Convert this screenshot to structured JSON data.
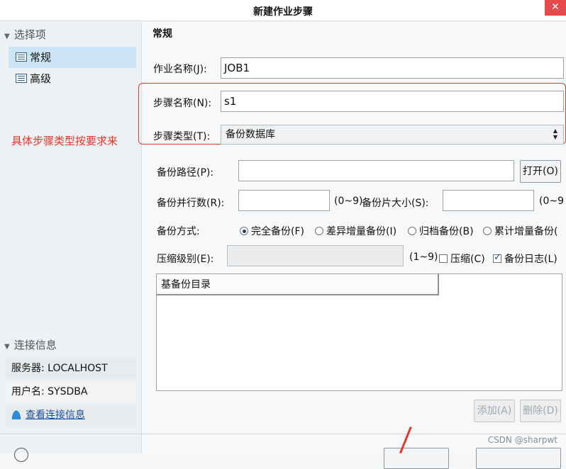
{
  "window": {
    "title": "新建作业步骤",
    "close": "✕"
  },
  "sidebar": {
    "options_header": "选择项",
    "items": [
      {
        "label": "常规",
        "icon": "list-icon",
        "active": true
      },
      {
        "label": "高级",
        "icon": "list-icon",
        "active": false
      }
    ],
    "connection_header": "连接信息",
    "server": "服务器: LOCALHOST",
    "user": "用户名: SYSDBA",
    "view_link": "查看连接信息"
  },
  "annotation": "具体步骤类型按要求来",
  "form": {
    "section": "常规",
    "job_name_label": "作业名称(J):",
    "job_name": "JOB1",
    "step_name_label": "步骤名称(N):",
    "step_name": "s1",
    "step_type_label": "步骤类型(T):",
    "step_type": "备份数据库",
    "backup_path_label": "备份路径(P):",
    "backup_path": "",
    "open_button": "打开(O)",
    "parallel_label": "备份并行数(R):",
    "parallel_value": "",
    "parallel_range": "(0~9)",
    "piece_size_label": "备份片大小(S):",
    "piece_size_value": "",
    "piece_range": "(0~9",
    "method_label": "备份方式:",
    "methods": [
      "完全备份(F)",
      "差异增量备份(I)",
      "归档备份(B)",
      "累计增量备份("
    ],
    "selected_method": 0,
    "compress_label": "压缩级别(E):",
    "compress_value": "",
    "compress_range": "(1~9)",
    "compress_checkbox": "压缩(C)",
    "compress_checked": false,
    "log_checkbox": "备份日志(L)",
    "log_checked": true,
    "table_header": "基备份目录",
    "add_button": "添加(A)",
    "delete_button": "删除(D)"
  },
  "watermark": "CSDN @sharpwt",
  "colors": {
    "accent": "#cbe5f5",
    "annotation": "#e3382a",
    "close": "#e64a4a"
  }
}
